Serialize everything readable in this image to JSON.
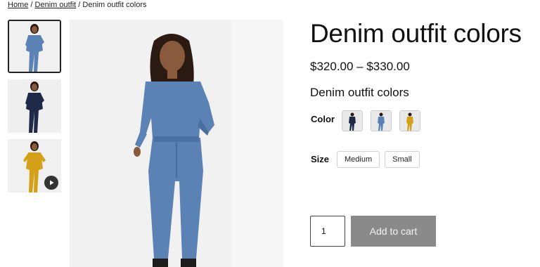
{
  "breadcrumb": {
    "home": "Home",
    "sep1": " / ",
    "category": "Denim outfit",
    "sep2": " / ",
    "current": "Denim outfit colors"
  },
  "product": {
    "title": "Denim outfit colors",
    "price": "$320.00 – $330.00",
    "subtitle": "Denim outfit colors"
  },
  "options": {
    "color_label": "Color",
    "size_label": "Size",
    "sizes": [
      "Medium",
      "Small"
    ]
  },
  "cart": {
    "quantity": "1",
    "add_to_cart_label": "Add to cart"
  },
  "colors": {
    "light_denim": "#5b82b4",
    "dark_denim": "#1e2a48",
    "mustard": "#d4a017",
    "skin": "#8a5a3c",
    "hair": "#2a1a12",
    "button_disabled": "#8a8a8a"
  }
}
